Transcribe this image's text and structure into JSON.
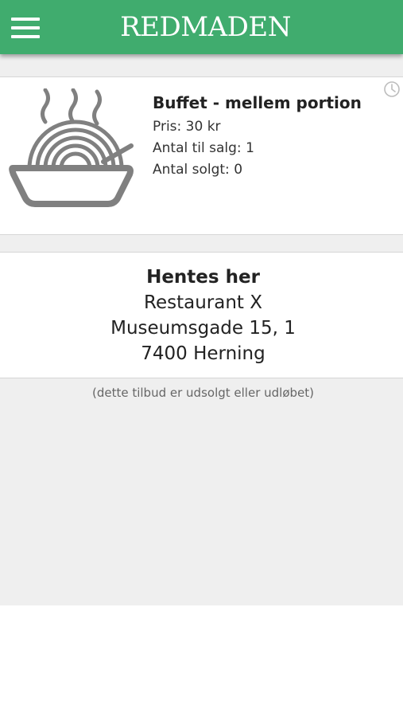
{
  "header": {
    "title": "REDMADEN",
    "menu_icon": "hamburger-menu-icon"
  },
  "offer": {
    "title": "Buffet - mellem portion",
    "price_label": "Pris:",
    "price_value": "30 kr",
    "for_sale_label": "Antal til salg:",
    "for_sale_value": "1",
    "sold_label": "Antal solgt:",
    "sold_value": "0",
    "image_icon": "food-bowl-icon",
    "time_icon": "clock-icon"
  },
  "pickup": {
    "heading": "Hentes her",
    "restaurant": "Restaurant X",
    "street": "Museumsgade 15, 1",
    "city": "7400 Herning"
  },
  "status_note": "(dette tilbud er udsolgt eller udløbet)",
  "colors": {
    "header_bg": "#40ac6e",
    "page_bg": "#efefef",
    "icon_gray": "#808080"
  }
}
